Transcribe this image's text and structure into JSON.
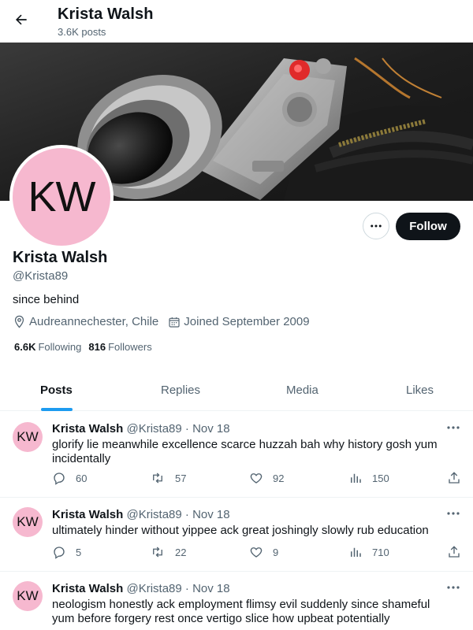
{
  "header": {
    "back_icon": "arrow-left-icon",
    "name": "Krista Walsh",
    "posts_count": "3.6K posts"
  },
  "profile": {
    "avatar_initials": "KW",
    "avatar_color": "#f6b8cf",
    "name": "Krista Walsh",
    "handle": "@Krista89",
    "bio": "since behind",
    "location": "Audreannechester, Chile",
    "joined": "Joined September 2009",
    "following_count": "6.6K",
    "following_label": "Following",
    "followers_count": "816",
    "followers_label": "Followers",
    "follow_label": "Follow",
    "more_icon": "more-horizontal-icon"
  },
  "tabs": [
    {
      "label": "Posts",
      "active": true
    },
    {
      "label": "Replies",
      "active": false
    },
    {
      "label": "Media",
      "active": false
    },
    {
      "label": "Likes",
      "active": false
    }
  ],
  "posts": [
    {
      "initials": "KW",
      "name": "Krista Walsh",
      "handle": "@Krista89",
      "dot": "·",
      "date": "Nov 18",
      "text": "glorify lie meanwhile excellence scarce huzzah bah why history gosh yum incidentally",
      "replies": "60",
      "reposts": "57",
      "likes": "92",
      "views": "150"
    },
    {
      "initials": "KW",
      "name": "Krista Walsh",
      "handle": "@Krista89",
      "dot": "·",
      "date": "Nov 18",
      "text": "ultimately hinder without yippee ack great joshingly slowly rub education",
      "replies": "5",
      "reposts": "22",
      "likes": "9",
      "views": "710"
    },
    {
      "initials": "KW",
      "name": "Krista Walsh",
      "handle": "@Krista89",
      "dot": "·",
      "date": "Nov 18",
      "text": "neologism honestly ack employment flimsy evil suddenly since shameful yum before forgery rest once vertigo slice how upbeat potentially",
      "replies": "",
      "reposts": "",
      "likes": "",
      "views": ""
    }
  ],
  "colors": {
    "accent": "#1d9bf0",
    "text": "#0f1419",
    "muted": "#536471",
    "follow_bg": "#0f1419"
  }
}
